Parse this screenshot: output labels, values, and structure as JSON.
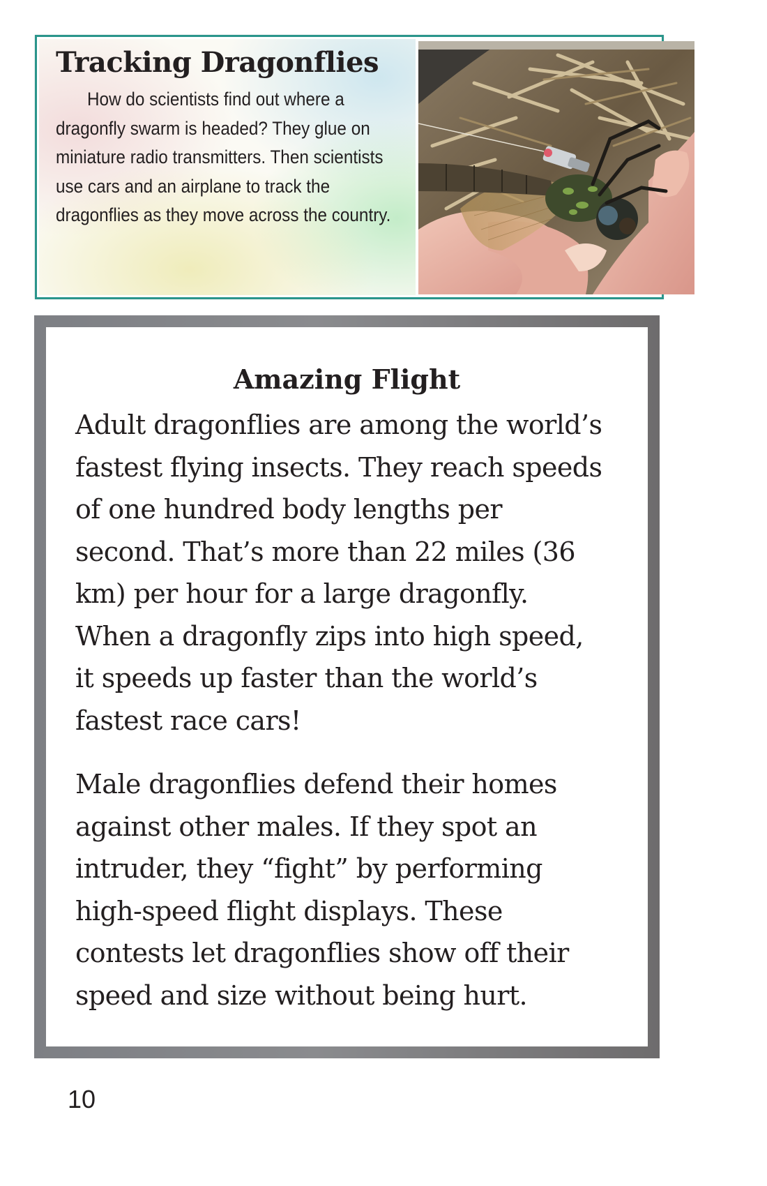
{
  "sidebar": {
    "title": "Tracking Dragonflies",
    "body": "How do scientists find out where a dragonfly swarm is headed? They glue on miniature radio transmitters. Then scientists use cars and an airplane to track the dragonflies as they move across the country.",
    "border_color": "#2a958b"
  },
  "feature": {
    "title": "Amazing Flight",
    "paragraphs": [
      "Adult dragonflies are among the world’s fastest flying insects. They reach speeds of one hundred body lengths per second. That’s more than 22 miles (36 km) per hour for a large dragonfly. When a dragonfly zips into high speed, it speeds up faster than the world’s fastest race cars!",
      "Male dragonflies defend their homes against other males. If they spot an intruder, they “fight” by performing high-speed flight displays. These contests let dragonflies show off their speed and size without being hurt."
    ]
  },
  "page": {
    "number": "10"
  }
}
